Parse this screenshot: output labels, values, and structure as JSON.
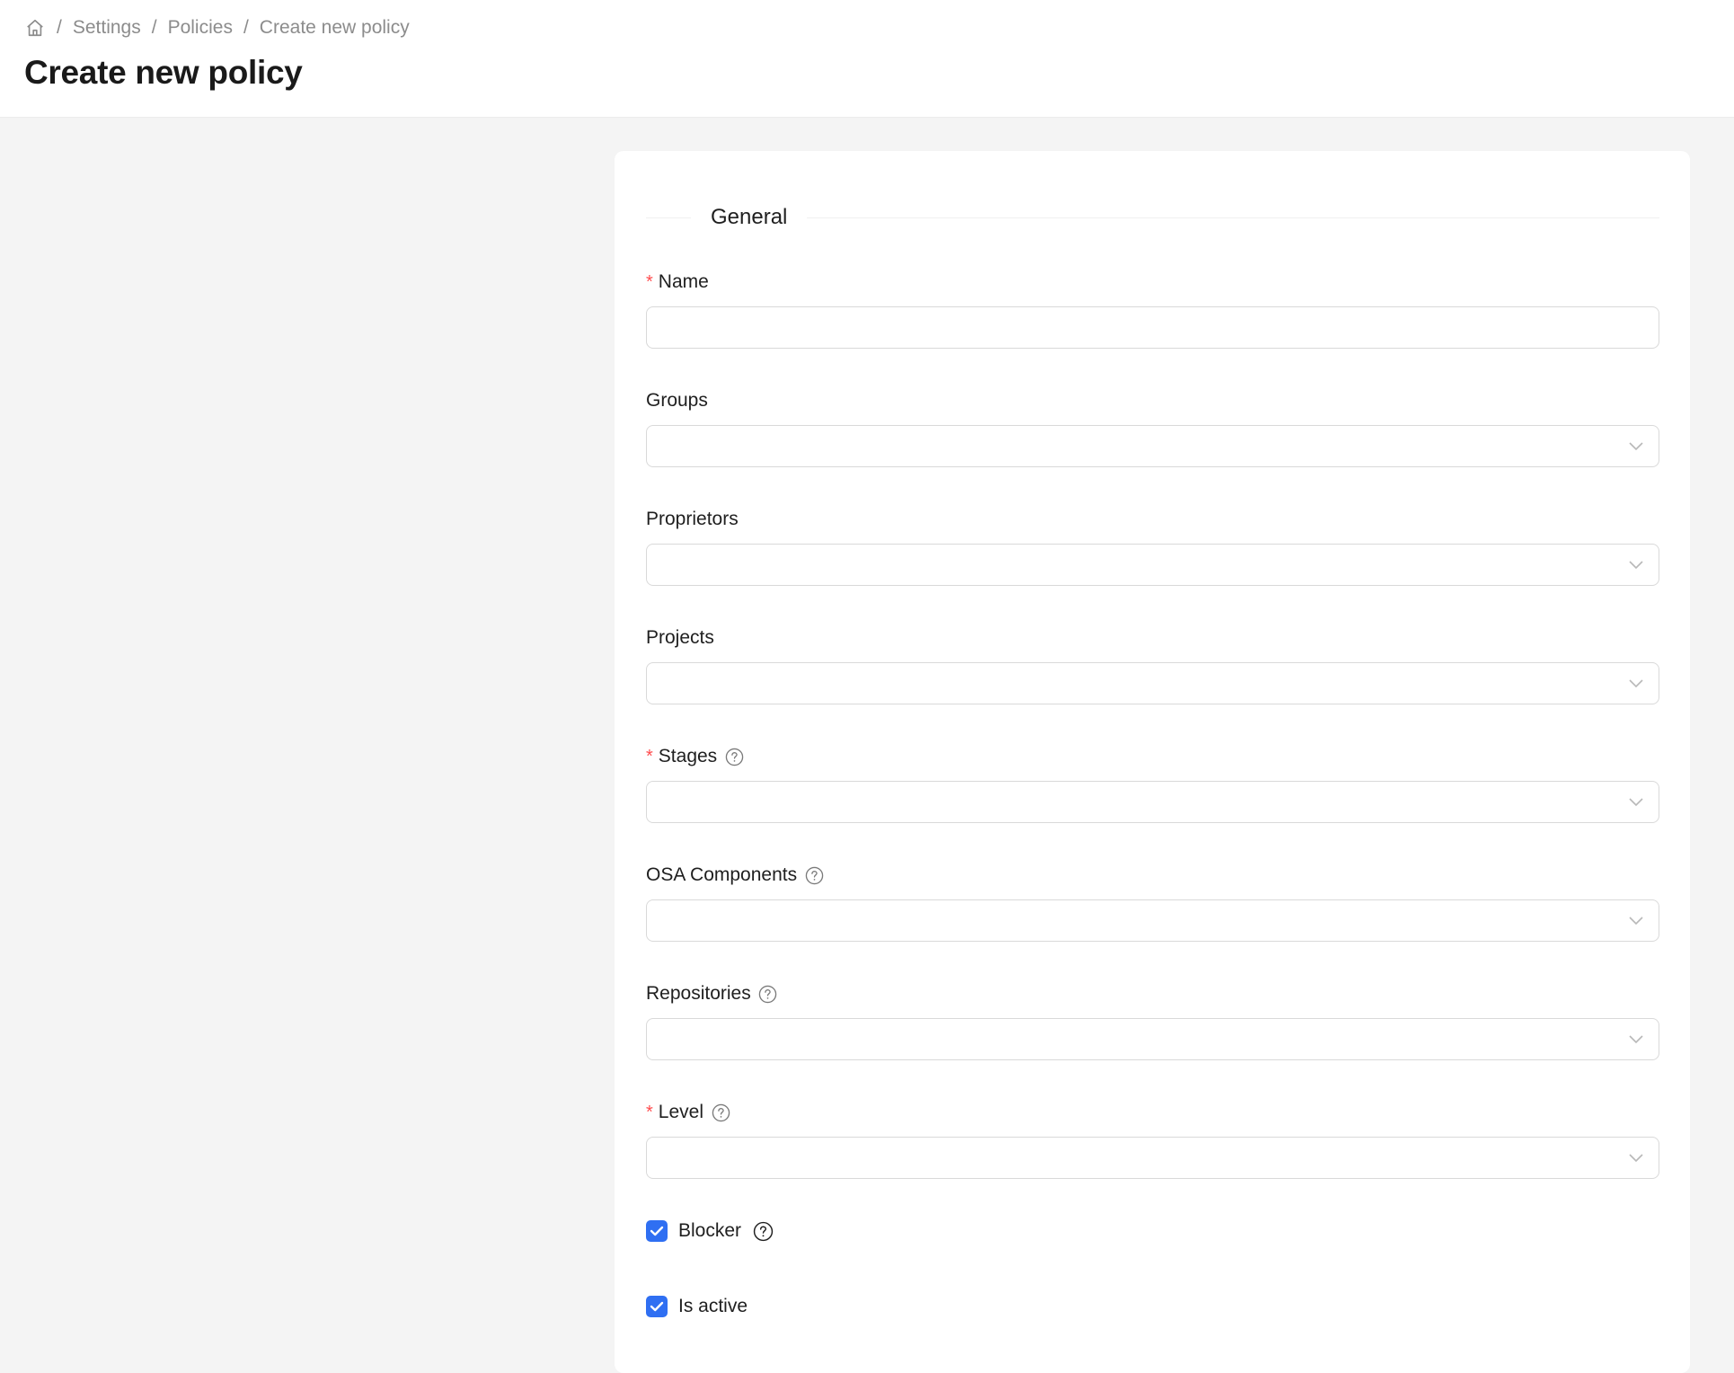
{
  "breadcrumb": {
    "icon": "home-icon",
    "items": [
      "Settings",
      "Policies",
      "Create new policy"
    ],
    "separator": "/"
  },
  "page": {
    "title": "Create new policy"
  },
  "section": {
    "title": "General"
  },
  "form": {
    "fields": [
      {
        "label": "Name",
        "required": true,
        "help": false,
        "type": "text",
        "value": ""
      },
      {
        "label": "Groups",
        "required": false,
        "help": false,
        "type": "select",
        "value": ""
      },
      {
        "label": "Proprietors",
        "required": false,
        "help": false,
        "type": "select",
        "value": ""
      },
      {
        "label": "Projects",
        "required": false,
        "help": false,
        "type": "select",
        "value": ""
      },
      {
        "label": "Stages",
        "required": true,
        "help": true,
        "type": "select",
        "value": ""
      },
      {
        "label": "OSA Components",
        "required": false,
        "help": true,
        "type": "select",
        "value": ""
      },
      {
        "label": "Repositories",
        "required": false,
        "help": true,
        "type": "select",
        "value": ""
      },
      {
        "label": "Level",
        "required": true,
        "help": true,
        "type": "select",
        "value": ""
      }
    ],
    "required_mark": "*",
    "checkboxes": [
      {
        "label": "Blocker",
        "checked": true,
        "help": true
      },
      {
        "label": "Is active",
        "checked": true,
        "help": false
      }
    ]
  },
  "colors": {
    "accent": "#2f6ff2",
    "required": "#ff4d4f",
    "background": "#f4f4f4",
    "card": "#ffffff"
  }
}
